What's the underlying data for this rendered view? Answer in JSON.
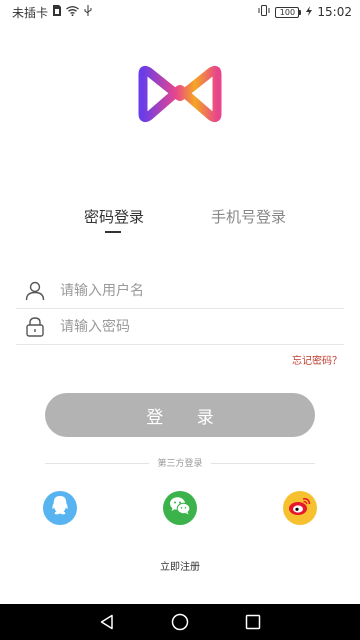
{
  "status_bar": {
    "carrier": "未插卡",
    "battery": "100",
    "time": "15:02"
  },
  "logo": {
    "name": "app-logo-m"
  },
  "tabs": {
    "password_login": "密码登录",
    "phone_login": "手机号登录"
  },
  "form": {
    "username_placeholder": "请输入用户名",
    "password_placeholder": "请输入密码",
    "forgot": "忘记密码？"
  },
  "login_button": "登 录",
  "third_party": {
    "label": "第三方登录",
    "providers": [
      "qq-icon",
      "wechat-icon",
      "weibo-icon"
    ]
  },
  "register": "立即注册",
  "colors": {
    "accent_purple": "#7b3fe4",
    "accent_pink": "#e8468b",
    "accent_orange": "#f5a623",
    "button_disabled": "#b3b3b3",
    "forgot_red": "#c0392b",
    "qq": "#58b4f0",
    "wechat": "#3cb34a",
    "weibo": "#f7c02f"
  }
}
